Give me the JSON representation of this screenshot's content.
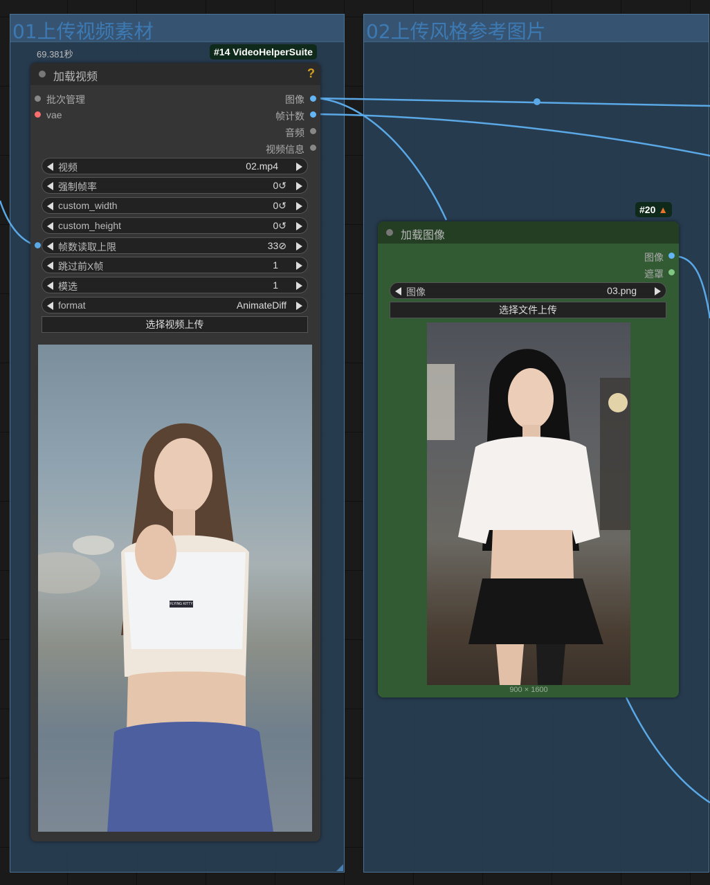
{
  "groups": {
    "upload_video": {
      "title": "01上传视频素材"
    },
    "upload_style": {
      "title": "02上传风格参考图片"
    }
  },
  "video_node": {
    "exec_time": "69.381秒",
    "badge": "#14 VideoHelperSuite",
    "title": "加载视频",
    "help_icon": "?",
    "inputs": [
      {
        "label": "批次管理",
        "color": "#888888"
      },
      {
        "label": "vae",
        "color": "#ff6e6e"
      }
    ],
    "outputs": [
      {
        "label": "图像",
        "color": "#64b5f6"
      },
      {
        "label": "帧计数",
        "color": "#64b5f6"
      },
      {
        "label": "音频",
        "color": "#888888"
      },
      {
        "label": "视频信息",
        "color": "#888888"
      }
    ],
    "widgets": [
      {
        "label": "视频",
        "value": "02.mp4"
      },
      {
        "label": "强制帧率",
        "value": "0↺"
      },
      {
        "label": "custom_width",
        "value": "0↺"
      },
      {
        "label": "custom_height",
        "value": "0↺"
      },
      {
        "label": "帧数读取上限",
        "value": "33⊘"
      },
      {
        "label": "跳过前X帧",
        "value": "1"
      },
      {
        "label": "模选",
        "value": "1"
      },
      {
        "label": "format",
        "value": "AnimateDiff"
      }
    ],
    "upload_button": "选择视频上传",
    "preview_print": "FLYING KITTY"
  },
  "image_node": {
    "badge": "#20",
    "badge_icon": "fox-icon",
    "title": "加载图像",
    "outputs": [
      {
        "label": "图像",
        "color": "#64b5f6"
      },
      {
        "label": "遮罩",
        "color": "#81c784"
      }
    ],
    "widget": {
      "label": "图像",
      "value": "03.png"
    },
    "upload_button": "选择文件上传",
    "dimensions": "900 × 1600"
  },
  "colors": {
    "wire": "#5aa9e6",
    "group_fill": "#283e54",
    "node_body_dark": "#353535",
    "node_body_green": "#335b33"
  }
}
